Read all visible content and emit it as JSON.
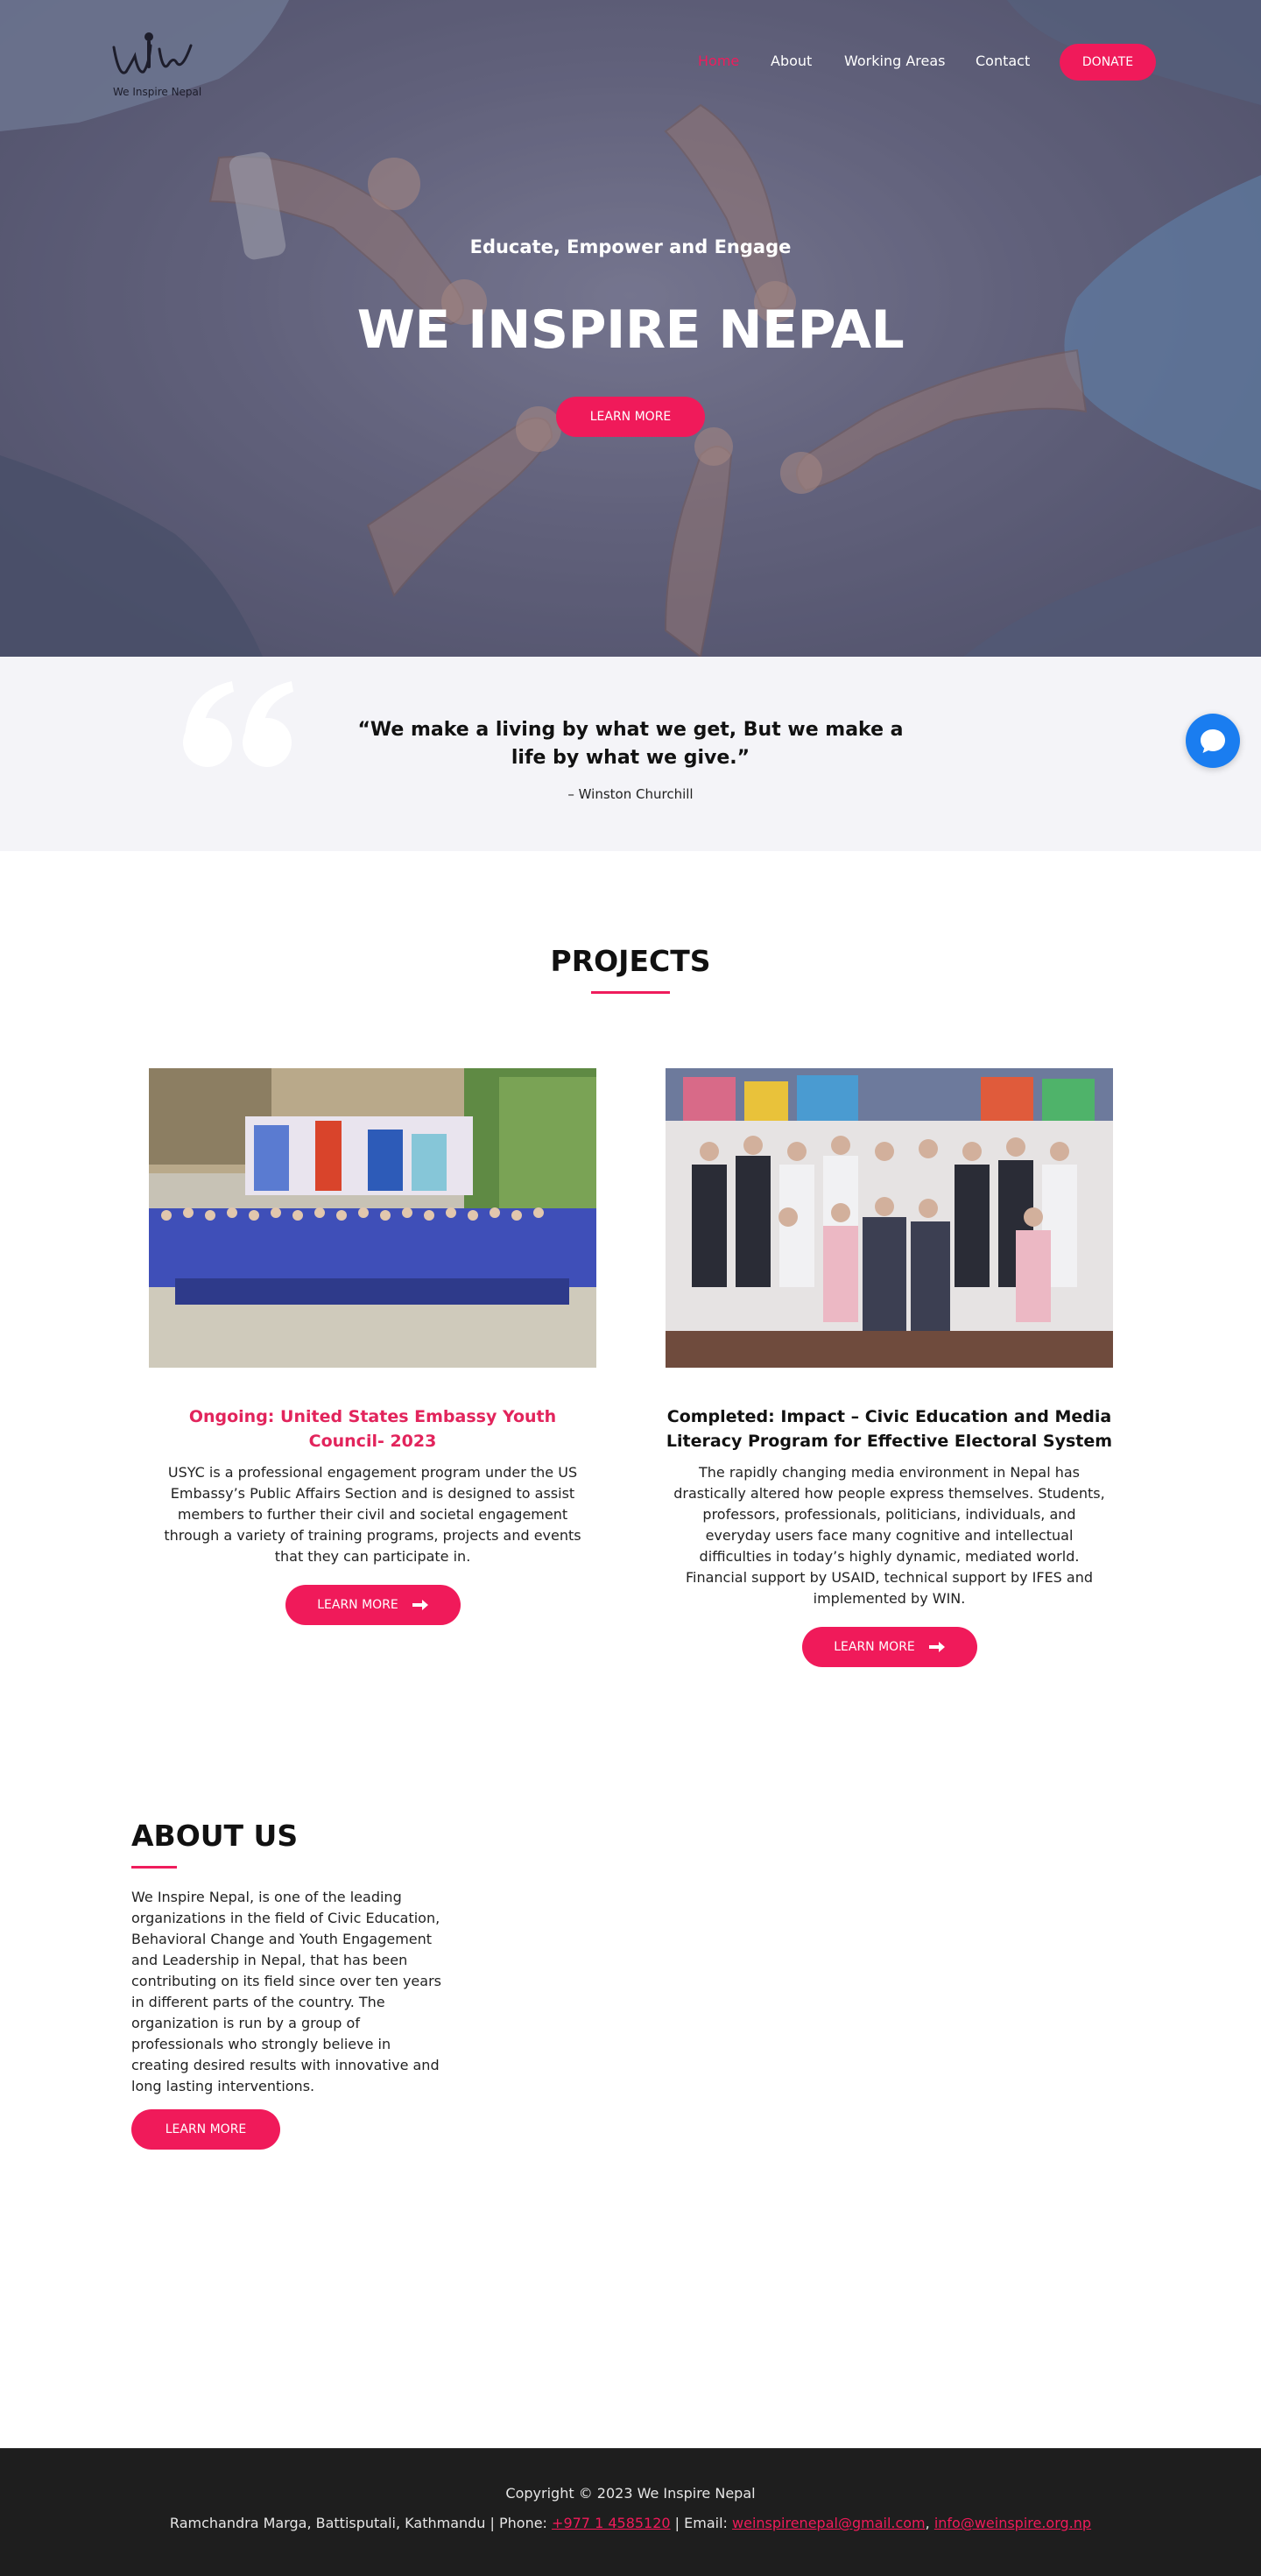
{
  "brand": {
    "logo_text": "We Inspire Nepal",
    "accent_color": "#f01a5a"
  },
  "nav": {
    "items": [
      {
        "label": "Home",
        "active": true
      },
      {
        "label": "About",
        "active": false
      },
      {
        "label": "Working Areas",
        "active": false
      },
      {
        "label": "Contact",
        "active": false
      }
    ],
    "donate_label": "DONATE"
  },
  "hero": {
    "tagline": "Educate, Empower and Engage",
    "title": "WE INSPIRE NEPAL",
    "button_label": "LEARN MORE"
  },
  "quote": {
    "text": "“We make a living by what we get, But we make a life by what we give.”",
    "author": "– Winston Churchill",
    "chat_icon": "chat-bubble-icon"
  },
  "projects": {
    "title": "PROJECTS",
    "items": [
      {
        "title": "Ongoing: United States Embassy Youth Council- 2023",
        "description": "USYC is a professional engagement program under the US Embassy’s Public Affairs Section and is designed to assist members to further their civil and societal engagement through a variety of training programs, projects and events that they can participate in.",
        "button_label": "LEARN MORE"
      },
      {
        "title": "Completed: Impact – Civic Education and Media Literacy Program for Effective Electoral System",
        "description": "The rapidly changing media environment in Nepal has drastically altered how people express themselves. Students, professors, professionals, politicians, individuals, and everyday users face many cognitive and intellectual difficulties in today’s highly dynamic, mediated world.",
        "description_2": "Financial support by USAID, technical support by IFES and implemented by WIN.",
        "button_label": "LEARN MORE"
      }
    ]
  },
  "about": {
    "title": "ABOUT US",
    "text": "We Inspire Nepal, is one of the leading organizations in the field of Civic Education, Behavioral Change and Youth Engagement and Leadership in Nepal, that has been contributing on its field since over ten years in different parts of the country. The organization is run by a group of professionals who strongly believe in creating desired results with innovative and long lasting interventions.",
    "button_label": "LEARN MORE"
  },
  "footer": {
    "copyright": "Copyright © 2023 We Inspire Nepal",
    "address": "Ramchandra Marga, Battisputali, Kathmandu | Phone: ",
    "phone": "+977 1 4585120",
    "email_label": " | Email: ",
    "email_1": "weinspirenepal@gmail.com",
    "separator": ", ",
    "email_2": "info@weinspire.org.np"
  }
}
